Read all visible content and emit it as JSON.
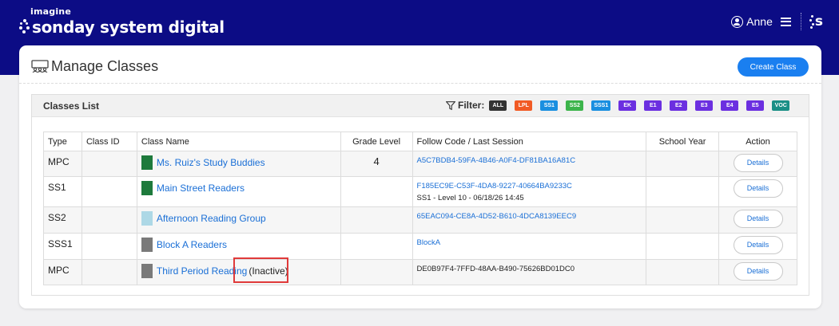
{
  "brand": {
    "small": "imagine",
    "main": "sonday system digital",
    "logo_letter": "s"
  },
  "user": {
    "name": "Anne",
    "user_icon": "user-circle-icon",
    "menu_icon": "hamburger-menu-icon"
  },
  "page": {
    "title": "Manage Classes",
    "title_icon": "classroom-icon",
    "create_label": "Create Class"
  },
  "panel": {
    "title": "Classes List",
    "filter_label": "Filter:",
    "filter_icon": "funnel-icon",
    "chips": [
      {
        "label": "ALL",
        "color": "#333333"
      },
      {
        "label": "LPL",
        "color": "#f15a24"
      },
      {
        "label": "SS1",
        "color": "#1a8fe0"
      },
      {
        "label": "SS2",
        "color": "#3cb44b"
      },
      {
        "label": "SSS1",
        "color": "#1a8fe0"
      },
      {
        "label": "EK",
        "color": "#6b2fe0"
      },
      {
        "label": "E1",
        "color": "#6b2fe0"
      },
      {
        "label": "E2",
        "color": "#6b2fe0"
      },
      {
        "label": "E3",
        "color": "#6b2fe0"
      },
      {
        "label": "E4",
        "color": "#6b2fe0"
      },
      {
        "label": "E5",
        "color": "#6b2fe0"
      },
      {
        "label": "VOC",
        "color": "#1a8f86"
      }
    ]
  },
  "table": {
    "headers": {
      "type": "Type",
      "class_id": "Class ID",
      "class_name": "Class Name",
      "grade_level": "Grade Level",
      "follow_code": "Follow Code / Last Session",
      "school_year": "School Year",
      "action": "Action"
    },
    "rows": [
      {
        "type": "MPC",
        "class_id": "",
        "name": "Ms. Ruiz's Study Buddies",
        "color": "#1e7a3c",
        "status": "",
        "grade": "4",
        "follow_code": "A5C7BDB4-59FA-4B46-A0F4-DF81BA16A81C",
        "last_session": "",
        "linked": true,
        "school_year": "",
        "action": "Details"
      },
      {
        "type": "SS1",
        "class_id": "",
        "name": "Main Street Readers",
        "color": "#1e7a3c",
        "status": "",
        "grade": "",
        "follow_code": "F185EC9E-C53F-4DA8-9227-40664BA9233C",
        "last_session": "SS1 - Level 10 - 06/18/26 14:45",
        "linked": true,
        "school_year": "",
        "action": "Details"
      },
      {
        "type": "SS2",
        "class_id": "",
        "name": "Afternoon Reading Group",
        "color": "#add8e6",
        "status": "",
        "grade": "",
        "follow_code": "65EAC094-CE8A-4D52-B610-4DCA8139EEC9",
        "last_session": "",
        "linked": true,
        "school_year": "",
        "action": "Details"
      },
      {
        "type": "SSS1",
        "class_id": "",
        "name": "Block A Readers",
        "color": "#7a7a7a",
        "status": "",
        "grade": "",
        "follow_code": "BlockA",
        "last_session": "",
        "linked": true,
        "school_year": "",
        "action": "Details"
      },
      {
        "type": "MPC",
        "class_id": "",
        "name": "Third Period Reading",
        "color": "#7a7a7a",
        "status": "(Inactive)",
        "grade": "",
        "follow_code": "DE0B97F4-7FFD-48AA-B490-75626BD01DC0",
        "last_session": "",
        "linked": false,
        "school_year": "",
        "action": "Details"
      }
    ]
  }
}
